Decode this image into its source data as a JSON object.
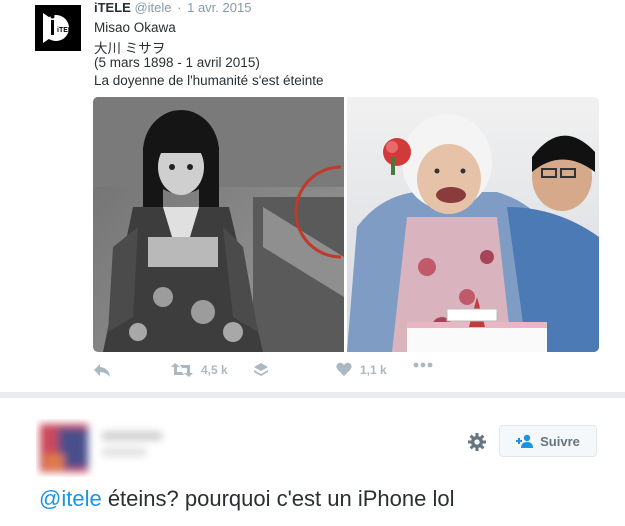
{
  "tweet": {
    "author_name": "iTELE",
    "handle": "@itele",
    "separator": "·",
    "date": "1 avr. 2015",
    "lines": [
      "Misao Okawa",
      "大川 ミサヲ",
      "(5 mars 1898 - 1 avril 2015)",
      "La doyenne de l'humanité s'est éteinte"
    ],
    "logo_text": "iTELE",
    "actions": {
      "retweet_count": "4,5 k",
      "like_count": "1,1 k"
    },
    "icons": [
      "reply-icon",
      "retweet-icon",
      "layers-icon",
      "heart-icon",
      "more-icon"
    ]
  },
  "reply_tweet": {
    "follow_label": "Suivre",
    "mention": "@itele",
    "text": " éteins? pourquoi c'est un iPhone lol",
    "icons": [
      "gear-icon",
      "follow-user-icon"
    ]
  },
  "colors": {
    "link": "#1b95e0",
    "muted": "#8899a6",
    "action_gray": "#aab8c2",
    "divider": "#e6ecf0"
  }
}
